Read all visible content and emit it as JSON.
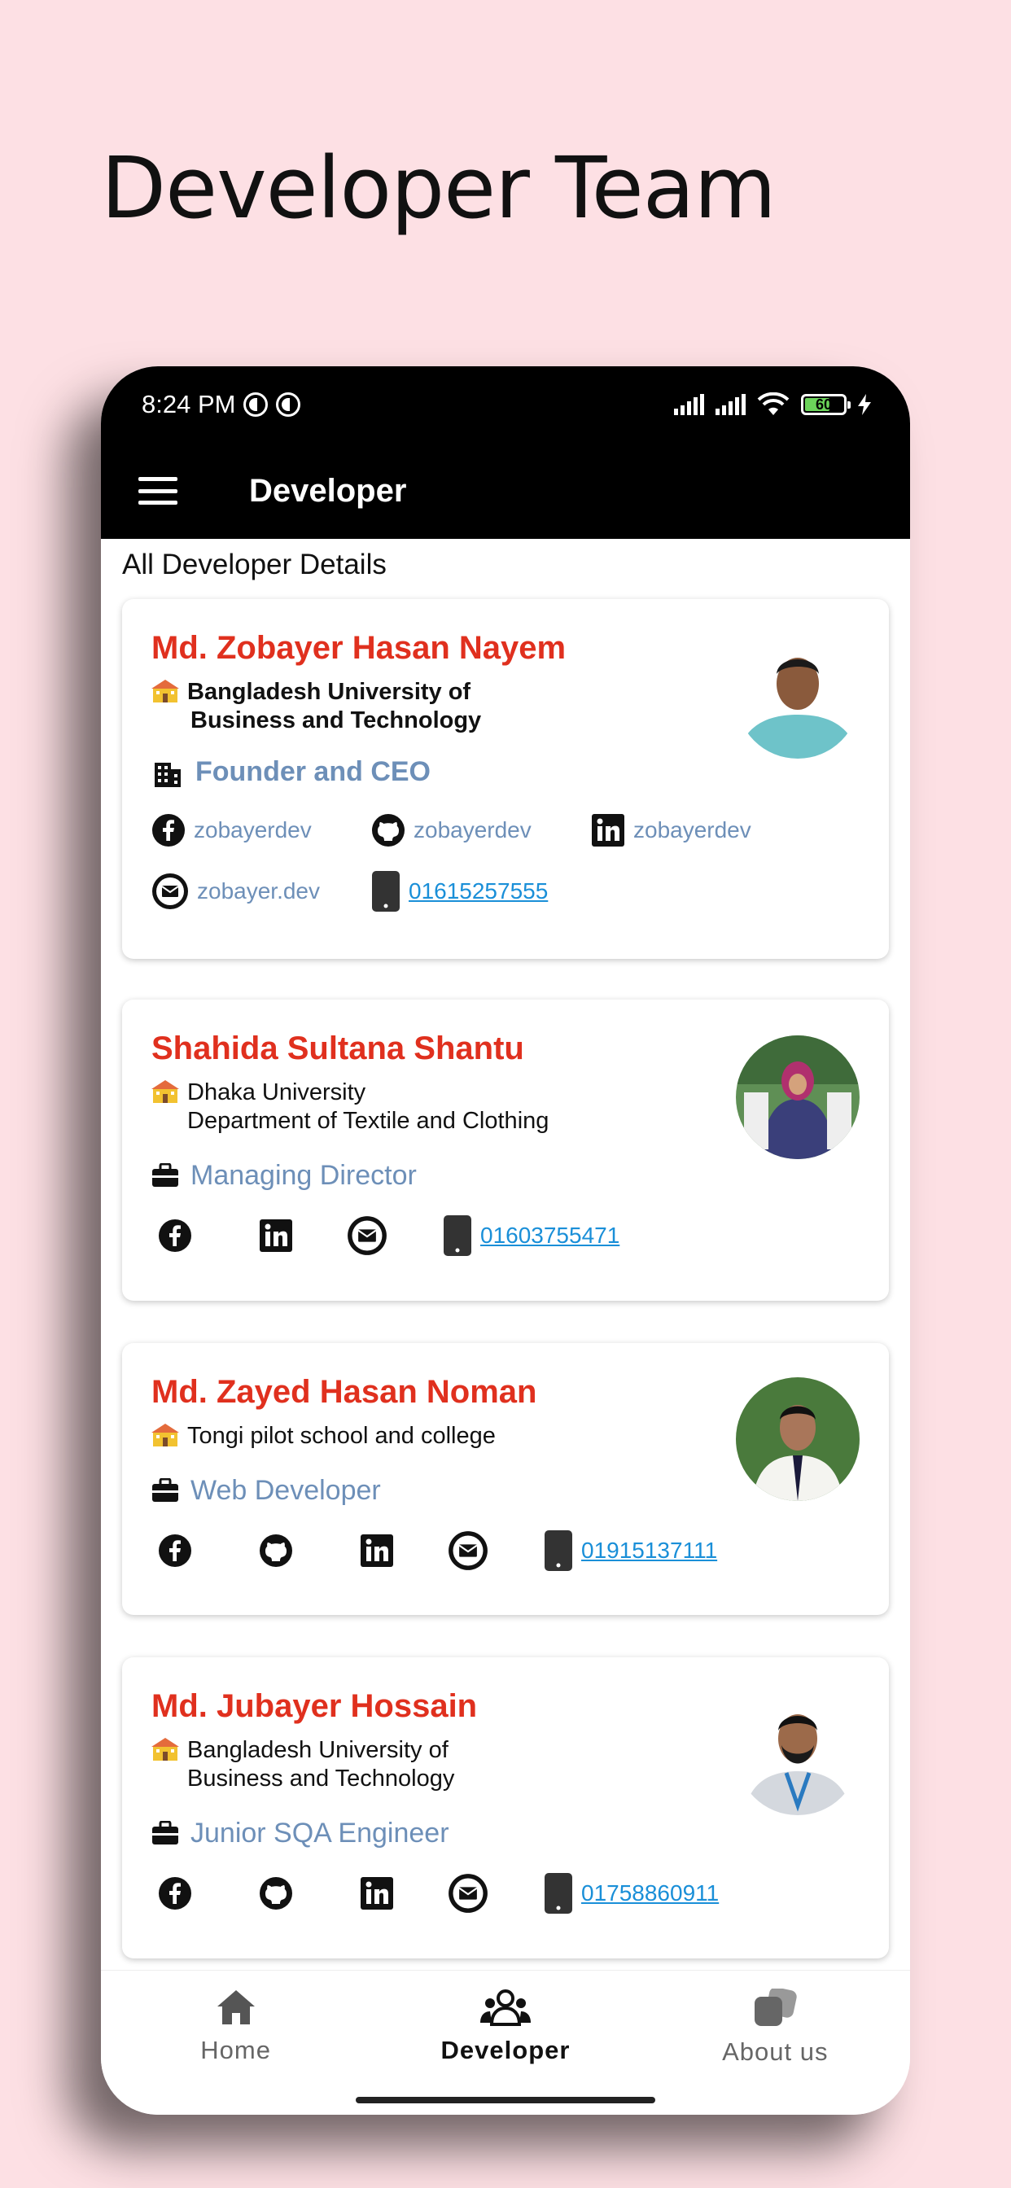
{
  "hero": {
    "title": "Developer Team"
  },
  "status_bar": {
    "time": "8:24 PM",
    "battery": "60"
  },
  "app_bar": {
    "title": "Developer"
  },
  "section_label": "All Developer Details",
  "developers": [
    {
      "name": "Md. Zobayer Hasan Nayem",
      "org_line1": "Bangladesh University of",
      "org_line2": "Business and Technology",
      "role": "Founder and CEO",
      "facebook": "zobayerdev",
      "github": "zobayerdev",
      "linkedin": "zobayerdev",
      "email": "zobayer.dev",
      "phone": "01615257555"
    },
    {
      "name": "Shahida Sultana Shantu",
      "org_line1": "Dhaka University",
      "org_line2": "Department of Textile and Clothing",
      "role": "Managing Director",
      "phone": "01603755471"
    },
    {
      "name": "Md. Zayed Hasan Noman",
      "org_line1": "Tongi pilot school and college",
      "role": "Web Developer",
      "phone": "01915137111"
    },
    {
      "name": "Md. Jubayer Hossain",
      "org_line1": "Bangladesh University of",
      "org_line2": "Business and Technology",
      "role": "Junior SQA Engineer",
      "phone": "01758860911"
    }
  ],
  "bottom_nav": [
    {
      "label": "Home",
      "icon": "home-icon"
    },
    {
      "label": "Developer",
      "icon": "group-icon",
      "active": true
    },
    {
      "label": "About us",
      "icon": "about-icon"
    }
  ],
  "colors": {
    "background": "#fde0e4",
    "name": "#e0301e",
    "role": "#6d8fb8",
    "phone_link": "#1a8fd8"
  }
}
